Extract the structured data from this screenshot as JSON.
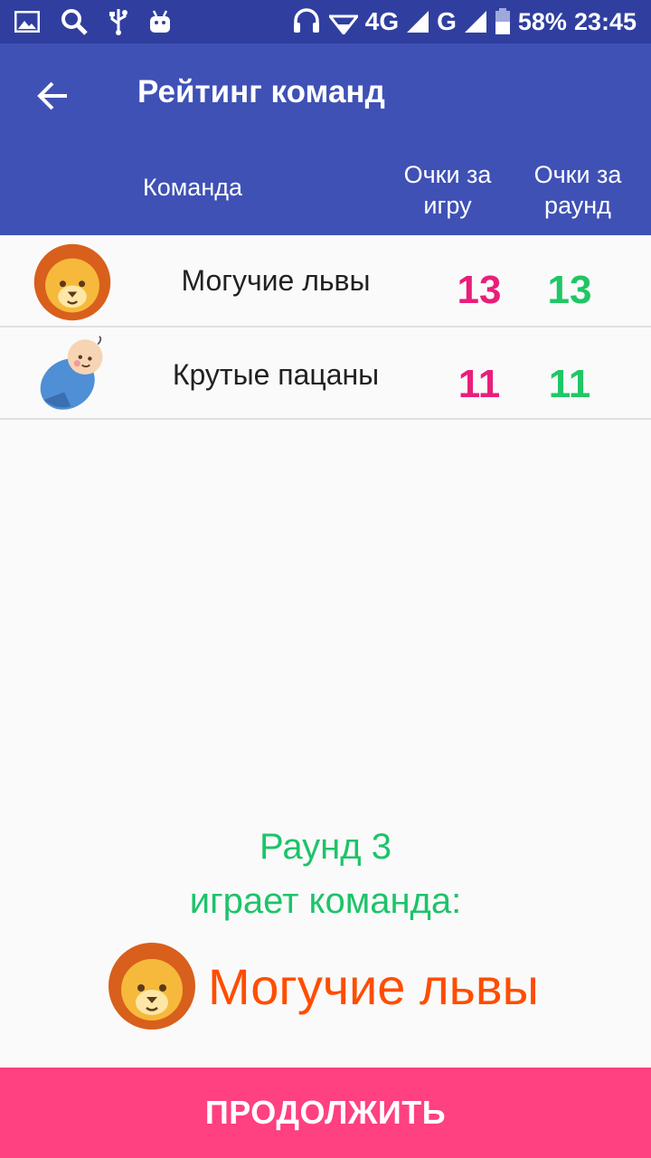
{
  "status_bar": {
    "network": "4G",
    "network2": "G",
    "battery": "58%",
    "time": "23:45"
  },
  "header": {
    "title": "Рейтинг команд",
    "columns": {
      "team": "Команда",
      "game_points": "Очки за игру",
      "round_points": "Очки за раунд"
    }
  },
  "teams": [
    {
      "name": "Могучие львы",
      "game_points": "13",
      "round_points": "13",
      "icon": "lion-icon"
    },
    {
      "name": "Крутые пацаны",
      "game_points": "11",
      "round_points": "11",
      "icon": "baby-icon"
    }
  ],
  "round": {
    "label": "Раунд 3",
    "playing": "играет команда:",
    "team_name": "Могучие львы",
    "team_icon": "lion-icon"
  },
  "actions": {
    "continue": "ПРОДОЛЖИТЬ"
  },
  "colors": {
    "primary": "#3f51b5",
    "primary_dark": "#303f9f",
    "accent": "#ff4081",
    "game_points": "#e91e7a",
    "round_points": "#21c665",
    "current_team": "#ff4d00"
  }
}
